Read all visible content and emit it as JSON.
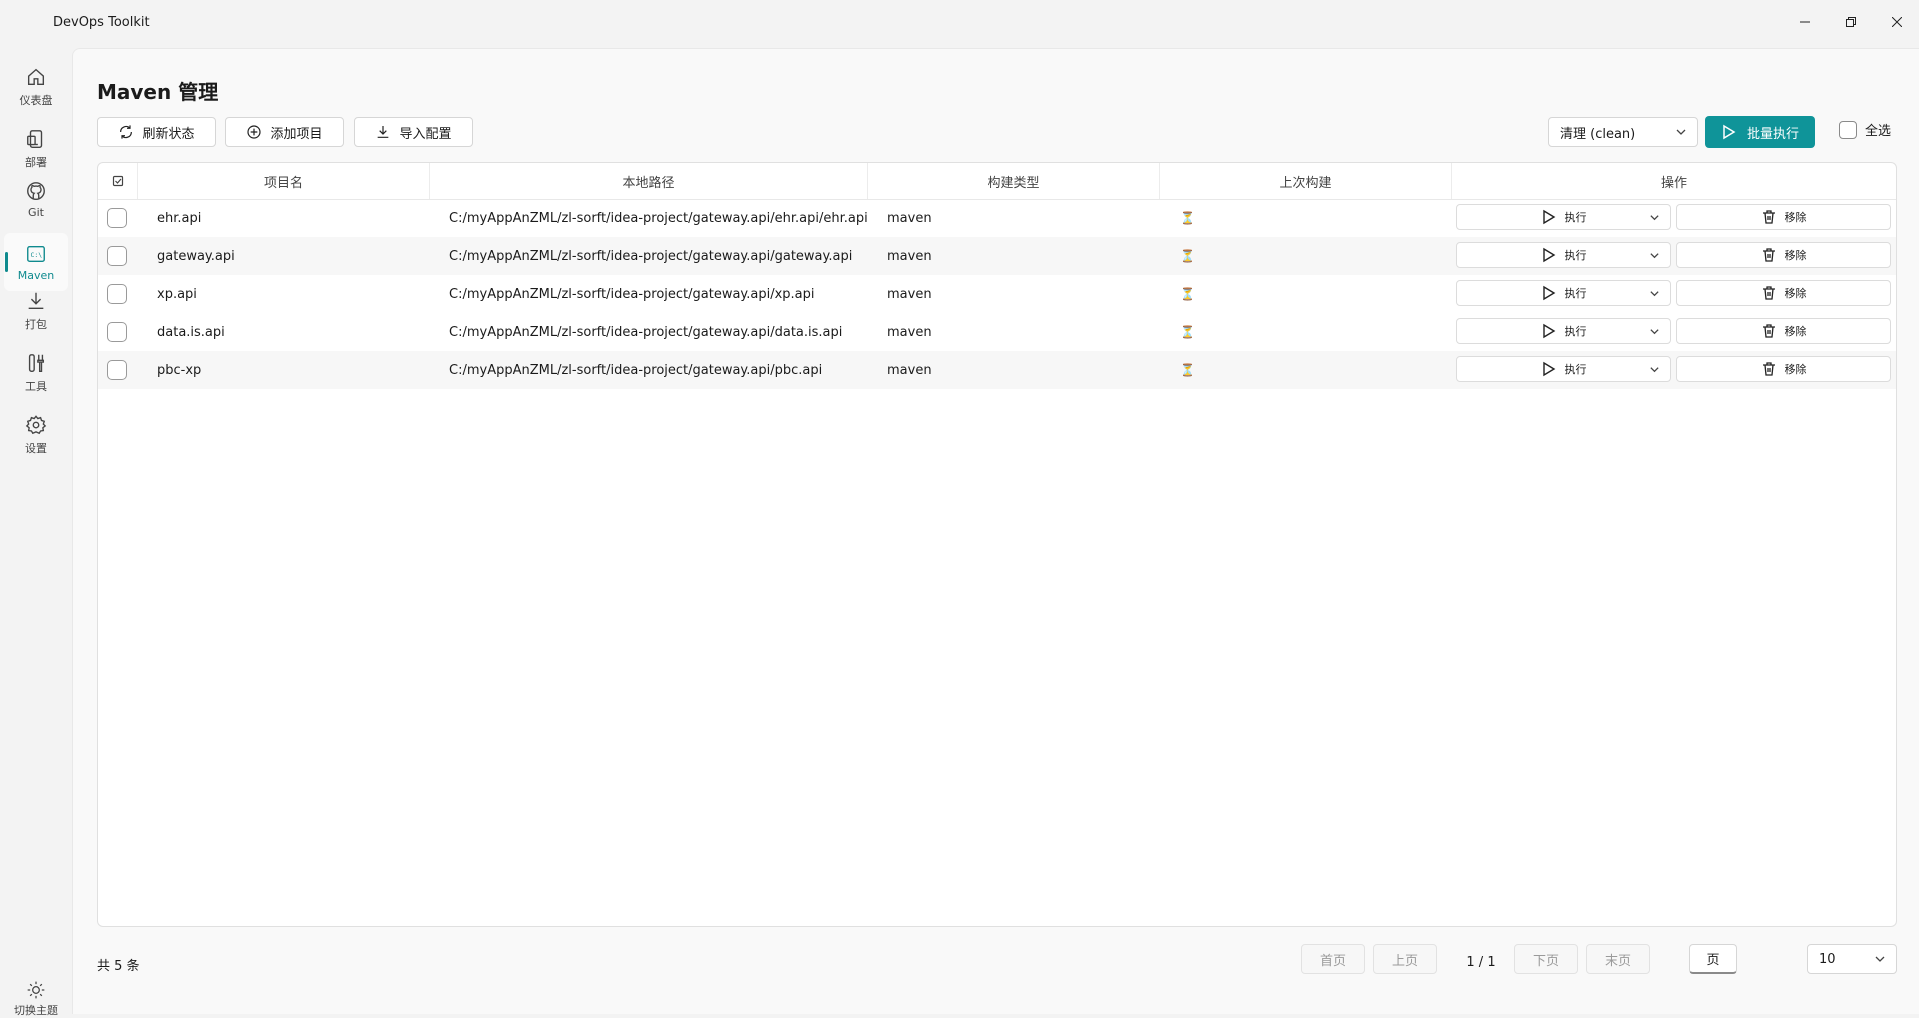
{
  "app": {
    "title": "DevOps Toolkit"
  },
  "sidebar": {
    "items": [
      {
        "label": "仪表盘",
        "icon": "home-icon"
      },
      {
        "label": "部署",
        "icon": "deploy-icon"
      },
      {
        "label": "Git",
        "icon": "github-icon"
      },
      {
        "label": "Maven",
        "icon": "terminal-icon",
        "active": true
      },
      {
        "label": "打包",
        "icon": "download-icon"
      },
      {
        "label": "工具",
        "icon": "tools-icon"
      },
      {
        "label": "设置",
        "icon": "gear-icon"
      }
    ],
    "theme_label": "切换主题"
  },
  "page": {
    "title": "Maven 管理"
  },
  "toolbar": {
    "refresh_label": "刷新状态",
    "add_label": "添加项目",
    "import_label": "导入配置",
    "goal_selected": "清理 (clean)",
    "batch_label": "批量执行",
    "select_all_label": "全选"
  },
  "table": {
    "columns": [
      "项目名",
      "本地路径",
      "构建类型",
      "上次构建",
      "操作"
    ],
    "rows": [
      {
        "name": "ehr.api",
        "path": "C:/myAppAnZML/zl-sorft/idea-project/gateway.api/ehr.api/ehr.api",
        "type": "maven",
        "last": "⏳"
      },
      {
        "name": "gateway.api",
        "path": "C:/myAppAnZML/zl-sorft/idea-project/gateway.api/gateway.api",
        "type": "maven",
        "last": "⏳"
      },
      {
        "name": "xp.api",
        "path": "C:/myAppAnZML/zl-sorft/idea-project/gateway.api/xp.api",
        "type": "maven",
        "last": "⏳"
      },
      {
        "name": "data.is.api",
        "path": "C:/myAppAnZML/zl-sorft/idea-project/gateway.api/data.is.api",
        "type": "maven",
        "last": "⏳"
      },
      {
        "name": "pbc-xp",
        "path": "C:/myAppAnZML/zl-sorft/idea-project/gateway.api/pbc.api",
        "type": "maven",
        "last": "⏳"
      }
    ],
    "run_label": "执行",
    "remove_label": "移除"
  },
  "footer": {
    "count_text": "共 5 条",
    "first": "首页",
    "prev": "上页",
    "page_info": "1 / 1",
    "next": "下页",
    "last": "末页",
    "page_input": "页",
    "page_size": "10"
  },
  "colors": {
    "accent": "#0f9499"
  }
}
